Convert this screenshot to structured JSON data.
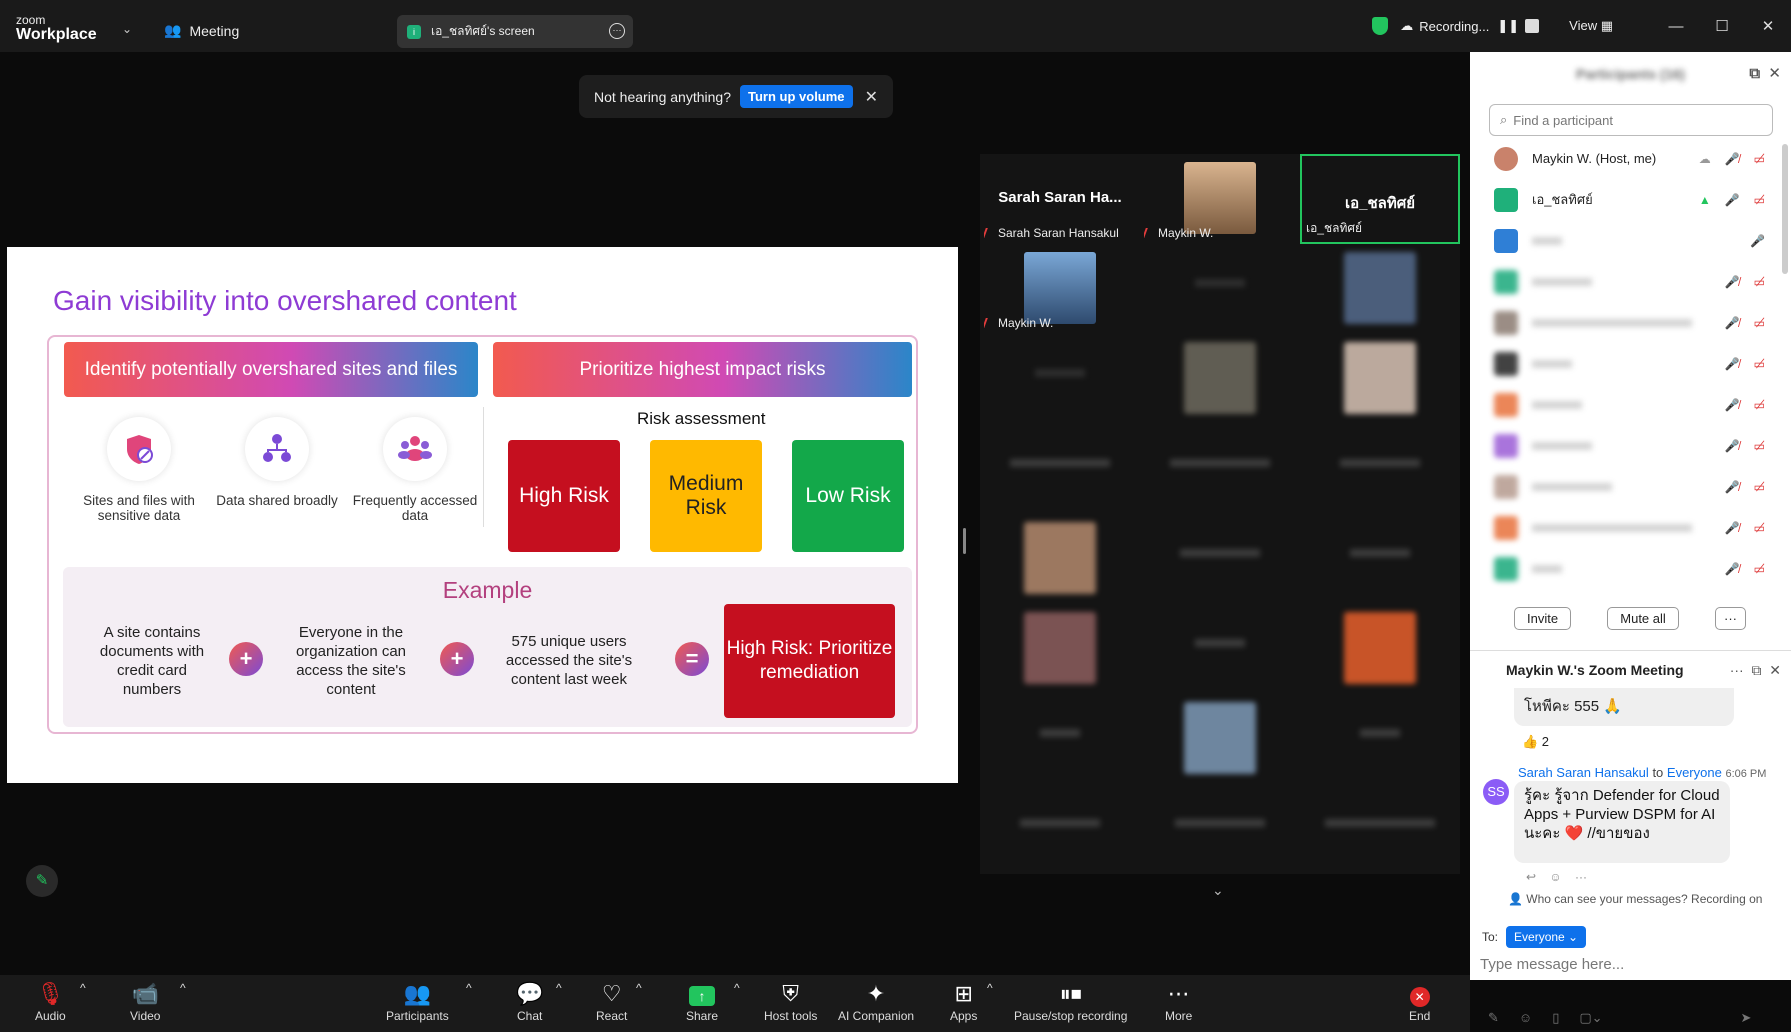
{
  "app": {
    "logo_small": "zoom",
    "logo_big": "Workplace",
    "meeting_label": "Meeting"
  },
  "screen_share": {
    "label": "เอ_ชลทิศย์'s screen",
    "badge": "i"
  },
  "recording": {
    "label": "Recording...",
    "view_label": "View"
  },
  "notify": {
    "text": "Not hearing anything?",
    "button": "Turn up volume"
  },
  "slide": {
    "title": "Gain visibility into overshared content",
    "header_left": "Identify potentially overshared sites and files",
    "header_right": "Prioritize highest impact risks",
    "features": [
      {
        "label": "Sites and files with sensitive data",
        "icon": "shield-icon"
      },
      {
        "label": "Data shared broadly",
        "icon": "share-nodes-icon"
      },
      {
        "label": "Frequently accessed data",
        "icon": "people-icon"
      }
    ],
    "risk_title": "Risk assessment",
    "risks": {
      "high": "High Risk",
      "medium": "Medium Risk",
      "low": "Low Risk"
    },
    "example_title": "Example",
    "example_steps": [
      "A site contains documents with credit card numbers",
      "Everyone in the organization can access the site's content",
      "575 unique users accessed the site's content last week"
    ],
    "operators": [
      "+",
      "+",
      "="
    ],
    "result": "High Risk: Prioritize remediation"
  },
  "gallery": {
    "tiles": [
      {
        "big": "Sarah Saran Ha...",
        "name": "Sarah Saran Hansakul"
      },
      {
        "big": "",
        "name": "Maykin W."
      },
      {
        "big": "เอ_ชลทิศย์",
        "name": "เอ_ชลทิศย์"
      },
      {
        "big": "",
        "name": "Maykin W."
      }
    ]
  },
  "participants": {
    "header": "Participants (16)",
    "search_placeholder": "Find a participant",
    "list": [
      {
        "name": "Maykin W. (Host, me)",
        "color": "#c9826b"
      },
      {
        "name": "เอ_ชลทิศย์",
        "color": "#1fb07a"
      },
      {
        "name": "",
        "color": "#2f7fd6"
      },
      {
        "name": "",
        "color": "#19a97b"
      },
      {
        "name": "",
        "color": "#8a7a70"
      },
      {
        "name": "",
        "color": "#222222"
      },
      {
        "name": "",
        "color": "#e8713b"
      },
      {
        "name": "",
        "color": "#9b5cd6"
      },
      {
        "name": "",
        "color": "#b59a8e"
      },
      {
        "name": "",
        "color": "#e8713b"
      },
      {
        "name": "",
        "color": "#19a97b"
      }
    ],
    "invite": "Invite",
    "mute_all": "Mute all",
    "more": "···"
  },
  "chat": {
    "title": "Maykin W.'s Zoom Meeting",
    "msg1": "โหพีคะ 555 🙏",
    "msg1_reaction": "👍 2",
    "sender": "Sarah Saran Hansakul",
    "to_word": "to",
    "to_target": "Everyone",
    "time": "6:06 PM",
    "avatar": "SS",
    "msg2": "รู้คะ รู้จาก Defender for Cloud Apps + Purview DSPM for AI นะคะ ❤️ //ขายของ",
    "who_can_see": "Who can see your messages? Recording on",
    "to_label": "To:",
    "to_value": "Everyone",
    "placeholder": "Type message here..."
  },
  "toolbar": {
    "audio": "Audio",
    "video": "Video",
    "participants": "Participants",
    "chat": "Chat",
    "react": "React",
    "share": "Share",
    "host_tools": "Host tools",
    "ai": "AI Companion",
    "apps": "Apps",
    "pause": "Pause/stop recording",
    "more": "More",
    "end": "End"
  }
}
